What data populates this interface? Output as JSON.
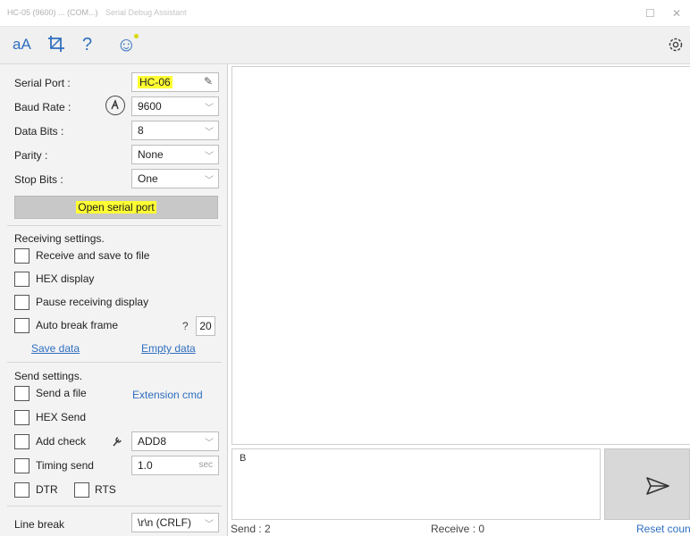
{
  "window": {
    "title": "HC-05 (9600) ... (COM...)",
    "subtitle": "Serial Debug Assistant"
  },
  "toolbar": {
    "font_icon": "aA",
    "crop_icon": "crop-icon",
    "help_icon": "?",
    "emoji_icon": "☺",
    "settings_icon": "gear-icon"
  },
  "serial": {
    "port_label": "Serial Port :",
    "port_value": "HC-06",
    "baud_label": "Baud Rate :",
    "baud_value": "9600",
    "databits_label": "Data Bits :",
    "databits_value": "8",
    "parity_label": "Parity :",
    "parity_value": "None",
    "stopbits_label": "Stop Bits :",
    "stopbits_value": "One",
    "open_button": "Open serial port"
  },
  "receiving": {
    "title": "Receiving settings.",
    "save_to_file": "Receive and save to file",
    "hex_display": "HEX display",
    "pause_display": "Pause receiving display",
    "auto_break": "Auto break frame",
    "auto_break_help": "?",
    "auto_break_value": "20",
    "save_data": "Save data",
    "empty_data": "Empty data"
  },
  "sending": {
    "title": "Send settings.",
    "send_file": "Send a file",
    "extension_cmd": "Extension cmd",
    "hex_send": "HEX Send",
    "add_check": "Add check",
    "add_check_value": "ADD8",
    "timing_send": "Timing send",
    "timing_value": "1.0",
    "timing_unit": "sec",
    "dtr": "DTR",
    "rts": "RTS",
    "line_break_label": "Line break",
    "line_break_value": "\\r\\n (CRLF)"
  },
  "send_box": {
    "text": "B"
  },
  "status": {
    "send": "Send : 2",
    "receive": "Receive : 0",
    "reset": "Reset coun"
  },
  "colors": {
    "accent": "#2f6fbf",
    "highlight": "#ffff33",
    "panel": "#f3f3f3"
  }
}
